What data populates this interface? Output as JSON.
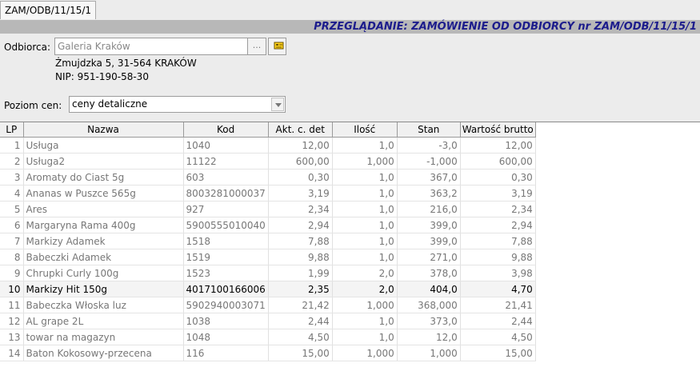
{
  "tab": {
    "label": "ZAM/ODB/11/15/1"
  },
  "header": {
    "title": "PRZEGLĄDANIE: ZAMÓWIENIE OD ODBIORCY nr ZAM/ODB/11/15/1"
  },
  "form": {
    "recipient_label": "Odbiorca:",
    "recipient_value": "Galeria Kraków",
    "browse_label": "...",
    "address": "Żmujdzka 5, 31-564 KRAKÓW",
    "nip": "NIP: 951-190-58-30",
    "price_level_label": "Poziom cen:",
    "price_level_value": "ceny detaliczne"
  },
  "table": {
    "columns": [
      "LP",
      "Nazwa",
      "Kod",
      "Akt. c. det",
      "Ilość",
      "Stan",
      "Wartość brutto"
    ],
    "selected_row": 9,
    "rows": [
      [
        "1",
        "Usługa",
        "1040",
        "12,00",
        "1,0",
        "-3,0",
        "12,00"
      ],
      [
        "2",
        "Usługa2",
        "11122",
        "600,00",
        "1,000",
        "-1,000",
        "600,00"
      ],
      [
        "3",
        "Aromaty do Ciast 5g",
        "603",
        "0,30",
        "1,0",
        "367,0",
        "0,30"
      ],
      [
        "4",
        "Ananas w Puszce 565g",
        "8003281000037",
        "3,19",
        "1,0",
        "363,2",
        "3,19"
      ],
      [
        "5",
        "Ares",
        "927",
        "2,34",
        "1,0",
        "216,0",
        "2,34"
      ],
      [
        "6",
        "Margaryna Rama 400g",
        "5900555010040",
        "2,94",
        "1,0",
        "399,0",
        "2,94"
      ],
      [
        "7",
        "Markizy Adamek",
        "1518",
        "7,88",
        "1,0",
        "399,0",
        "7,88"
      ],
      [
        "8",
        "Babeczki Adamek",
        "1519",
        "9,88",
        "1,0",
        "271,0",
        "9,88"
      ],
      [
        "9",
        "Chrupki Curly 100g",
        "1523",
        "1,99",
        "2,0",
        "378,0",
        "3,98"
      ],
      [
        "10",
        "Markizy Hit 150g",
        "4017100166006",
        "2,35",
        "2,0",
        "404,0",
        "4,70"
      ],
      [
        "11",
        "Babeczka Włoska luz",
        "5902940003071",
        "21,42",
        "1,000",
        "368,000",
        "21,41"
      ],
      [
        "12",
        "AL grape 2L",
        "1038",
        "2,44",
        "1,0",
        "373,0",
        "2,44"
      ],
      [
        "13",
        "towar na magazyn",
        "1048",
        "4,50",
        "1,0",
        "12,0",
        "4,50"
      ],
      [
        "14",
        "Baton Kokosowy-przecena",
        "116",
        "15,00",
        "1,000",
        "1,000",
        "15,00"
      ]
    ]
  },
  "icons": {
    "lookup": "lookup-card-icon",
    "dropdown": "chevron-down-icon"
  }
}
